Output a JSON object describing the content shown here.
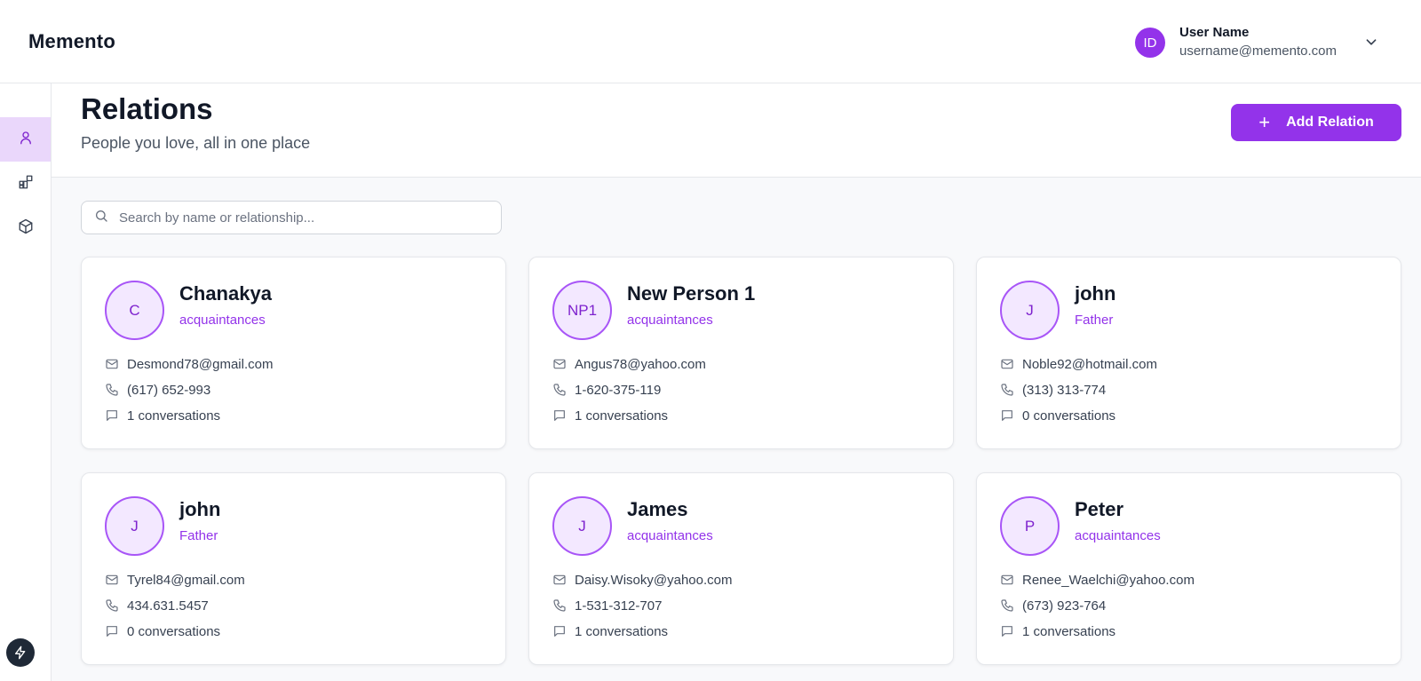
{
  "app": {
    "brand": "Memento"
  },
  "user": {
    "initials": "ID",
    "name": "User Name",
    "email": "username@memento.com"
  },
  "page": {
    "title": "Relations",
    "subtitle": "People you love, all in one place",
    "add_button_label": "Add Relation"
  },
  "search": {
    "placeholder": "Search by name or relationship...",
    "value": ""
  },
  "colors": {
    "accent": "#9333ea",
    "avatar_bg": "#f3e8ff",
    "active_nav_bg": "#ead7fb"
  },
  "sidebar": {
    "items": [
      {
        "icon": "user-icon",
        "active": true
      },
      {
        "icon": "grid-plus-icon",
        "active": false
      },
      {
        "icon": "box-icon",
        "active": false
      }
    ]
  },
  "relations": [
    {
      "initials": "C",
      "name": "Chanakya",
      "relationship": "acquaintances",
      "email": "Desmond78@gmail.com",
      "phone": "(617) 652-993",
      "conversations": "1 conversations"
    },
    {
      "initials": "NP1",
      "name": "New Person 1",
      "relationship": "acquaintances",
      "email": "Angus78@yahoo.com",
      "phone": "1-620-375-119",
      "conversations": "1 conversations"
    },
    {
      "initials": "J",
      "name": "john",
      "relationship": "Father",
      "email": "Noble92@hotmail.com",
      "phone": "(313) 313-774",
      "conversations": "0 conversations"
    },
    {
      "initials": "J",
      "name": "john",
      "relationship": "Father",
      "email": "Tyrel84@gmail.com",
      "phone": "434.631.5457",
      "conversations": "0 conversations"
    },
    {
      "initials": "J",
      "name": "James",
      "relationship": "acquaintances",
      "email": "Daisy.Wisoky@yahoo.com",
      "phone": "1-531-312-707",
      "conversations": "1 conversations"
    },
    {
      "initials": "P",
      "name": "Peter",
      "relationship": "acquaintances",
      "email": "Renee_Waelchi@yahoo.com",
      "phone": "(673) 923-764",
      "conversations": "1 conversations"
    }
  ]
}
